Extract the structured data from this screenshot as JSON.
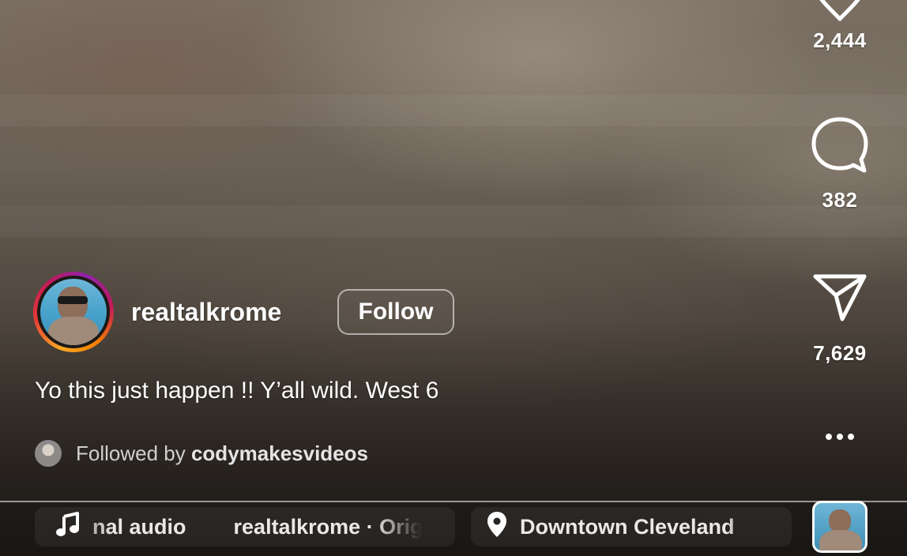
{
  "reel": {
    "likes": "2,444",
    "comments": "382",
    "shares": "7,629"
  },
  "author": {
    "username": "realtalkrome",
    "follow_label": "Follow"
  },
  "caption": "Yo this just happen !! Y’all wild. West 6",
  "followed_by": {
    "prefix": "Followed by",
    "username": "codymakesvideos"
  },
  "audio": {
    "text": "Original audio        realtalkrome · Original audio",
    "location": "Downtown Cleveland"
  },
  "icons": {
    "like": "heart-icon",
    "comment": "comment-icon",
    "share": "paper-plane-icon",
    "more": "more-horizontal-icon",
    "music": "music-note-icon",
    "location": "location-pin-icon"
  },
  "colors": {
    "ring_start": "#f9a825",
    "ring_end": "#8e24aa"
  }
}
